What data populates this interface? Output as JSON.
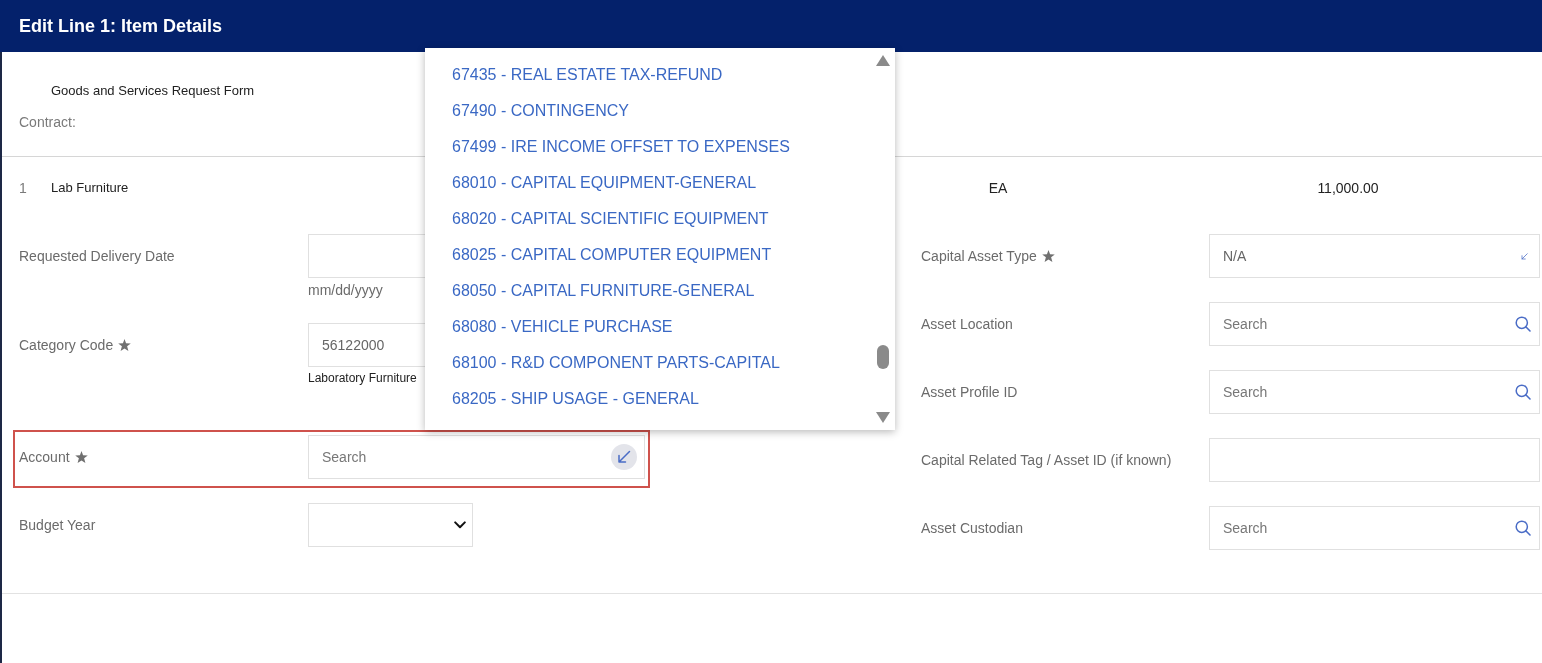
{
  "window": {
    "title": "Edit Line 1: Item Details"
  },
  "form_header": {
    "form_name": "Goods and Services Request Form",
    "contract_label": "Contract:"
  },
  "line_item": {
    "number": "1",
    "description": "Lab Furniture",
    "unit": "EA",
    "amount": "11,000.00"
  },
  "left_fields": [
    {
      "label": "Requested Delivery Date",
      "required": false,
      "kind": "text",
      "helper_text": "mm/dd/yyyy",
      "active": false,
      "highlighted": false
    },
    {
      "label": "Category Code",
      "required": true,
      "kind": "text",
      "value": "56122000",
      "helper_text": "Laboratory Furniture",
      "active": false,
      "highlighted": false
    },
    {
      "label": "Account",
      "required": true,
      "kind": "lookup",
      "placeholder": "Search",
      "active": true,
      "highlighted": true,
      "options": [
        "67435 - REAL ESTATE TAX-REFUND",
        "67490 - CONTINGENCY",
        "67499 - IRE INCOME OFFSET TO EXPENSES",
        "68010 - CAPITAL EQUIPMENT-GENERAL",
        "68020 - CAPITAL SCIENTIFIC EQUIPMENT",
        "68025 - CAPITAL COMPUTER EQUIPMENT",
        "68050 - CAPITAL FURNITURE-GENERAL",
        "68080 - VEHICLE PURCHASE",
        "68100 - R&D COMPONENT PARTS-CAPITAL",
        "68205 - SHIP USAGE - GENERAL"
      ]
    },
    {
      "label": "Budget Year",
      "required": false,
      "kind": "select",
      "active": false,
      "highlighted": false
    }
  ],
  "right_fields": [
    {
      "label": "Capital Asset Type",
      "required": true,
      "kind": "lookup",
      "value": "N/A",
      "active": false
    },
    {
      "label": "Asset Location",
      "required": false,
      "kind": "search",
      "placeholder": "Search",
      "active": false
    },
    {
      "label": "Asset Profile ID",
      "required": false,
      "kind": "search",
      "placeholder": "Search",
      "active": false
    },
    {
      "label": "Capital Related Tag / Asset ID (if known)",
      "required": false,
      "kind": "text",
      "active": false
    },
    {
      "label": "Asset Custodian",
      "required": false,
      "kind": "search",
      "placeholder": "Search",
      "active": false
    }
  ]
}
